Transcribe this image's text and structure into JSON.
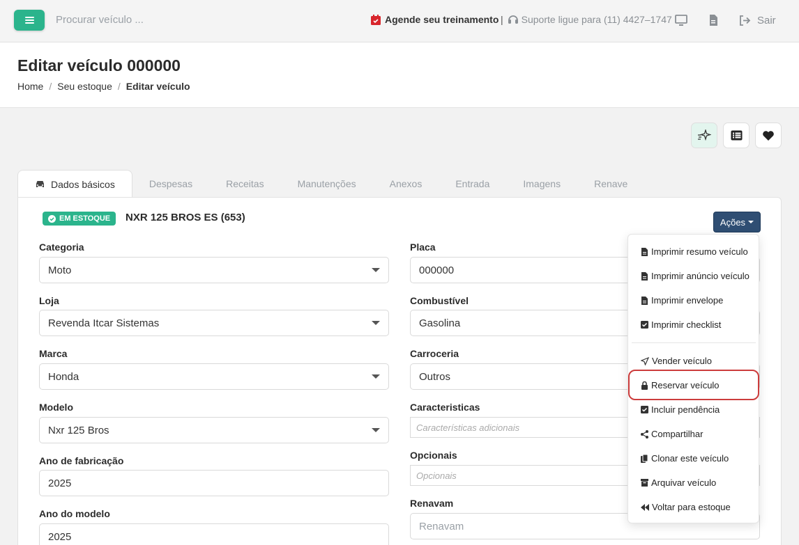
{
  "topbar": {
    "search_placeholder": "Procurar veículo ...",
    "training": "Agende seu treinamento",
    "separator": "|",
    "support": "Suporte ligue para (11) 4427–1747",
    "logout": "Sair"
  },
  "header": {
    "title": "Editar veículo 000000",
    "breadcrumb": [
      "Home",
      "Seu estoque",
      "Editar veículo"
    ]
  },
  "tabs": [
    "Dados básicos",
    "Despesas",
    "Receitas",
    "Manutenções",
    "Anexos",
    "Entrada",
    "Imagens",
    "Renave"
  ],
  "vehicle": {
    "status_badge": "EM ESTOQUE",
    "name": "NXR 125 BROS ES (653)"
  },
  "actions_label": "Ações",
  "left_fields": [
    {
      "label": "Categoria",
      "value": "Moto"
    },
    {
      "label": "Loja",
      "value": "Revenda Itcar Sistemas"
    },
    {
      "label": "Marca",
      "value": "Honda"
    },
    {
      "label": "Modelo",
      "value": "Nxr 125 Bros"
    },
    {
      "label": "Ano de fabricação",
      "value": "2025"
    },
    {
      "label": "Ano do modelo",
      "value": "2025"
    }
  ],
  "right_fields": [
    {
      "label": "Placa",
      "value": "000000"
    },
    {
      "label": "Combustível",
      "value": "Gasolina"
    },
    {
      "label": "Carroceria",
      "value": "Outros"
    },
    {
      "label": "Caracteristicas",
      "placeholder": "Características adicionais"
    },
    {
      "label": "Opcionais",
      "placeholder": "Opcionais"
    },
    {
      "label": "Renavam",
      "placeholder": "Renavam"
    }
  ],
  "menu_items": [
    "Imprimir resumo veículo",
    "Imprimir anúncio veículo",
    "Imprimir envelope",
    "Imprimir checklist",
    "Vender veículo",
    "Reservar veículo",
    "Incluir pendência",
    "Compartilhar",
    "Clonar este veículo",
    "Arquivar veículo",
    "Voltar para estoque"
  ],
  "colors": {
    "accent": "#2bb48c",
    "actions_button": "#2f4e73",
    "highlight": "#cc3c3c"
  }
}
